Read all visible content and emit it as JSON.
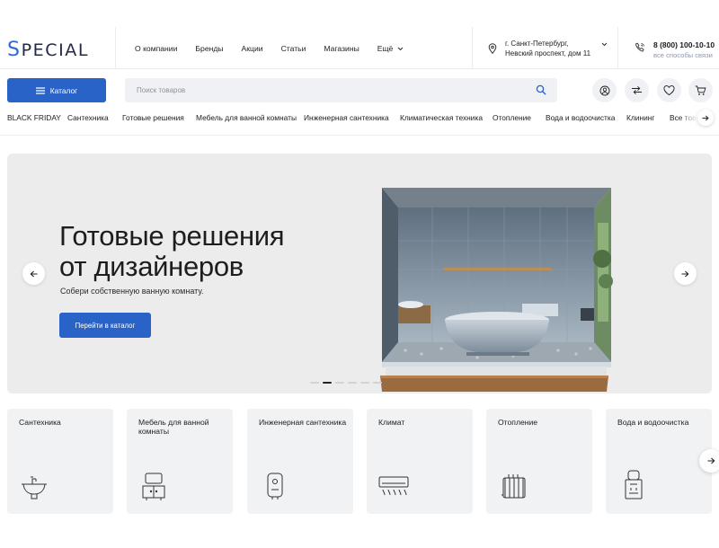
{
  "brand": {
    "logo_cap": "S",
    "logo_rest": "PECIAL"
  },
  "top_nav": [
    "О компании",
    "Бренды",
    "Акции",
    "Статьи",
    "Магазины",
    "Ещё"
  ],
  "location": {
    "line1": "г. Санкт-Петербург,",
    "line2": "Невский проспект, дом 11"
  },
  "contact": {
    "phone": "8 (800) 100-10-10",
    "sub": "все способы связи"
  },
  "catalog_button": "Каталог",
  "search": {
    "placeholder": "Поиск товаров",
    "value": ""
  },
  "header_icons": [
    "user-icon",
    "compare-icon",
    "heart-icon",
    "cart-icon"
  ],
  "categories": [
    "BLACK FRIDAY",
    "Сантехника",
    "Готовые решения",
    "Мебель для ванной комнаты",
    "Инженерная сантехника",
    "Климатическая техника",
    "Отопление",
    "Вода и водоочистка",
    "Клининг",
    "Все товары"
  ],
  "hero": {
    "title_line1": "Готовые решения",
    "title_line2": "от дизайнеров",
    "subtitle": "Собери собственную ванную комнату.",
    "button": "Перейти в каталог",
    "slides_count": 6,
    "active_slide": 2
  },
  "category_cards": [
    {
      "title": "Сантехника",
      "icon": "sink-icon"
    },
    {
      "title": "Мебель для ванной комнаты",
      "icon": "vanity-icon"
    },
    {
      "title": "Инженерная сантехника",
      "icon": "water-heater-icon"
    },
    {
      "title": "Климат",
      "icon": "air-conditioner-icon"
    },
    {
      "title": "Отопление",
      "icon": "radiator-icon"
    },
    {
      "title": "Вода и водоочистка",
      "icon": "water-cooler-icon"
    }
  ],
  "colors": {
    "accent": "#2a63c7",
    "logo_dark": "#202a4a",
    "muted": "#8f97ad",
    "panel": "#ececed",
    "card": "#f1f2f4"
  }
}
